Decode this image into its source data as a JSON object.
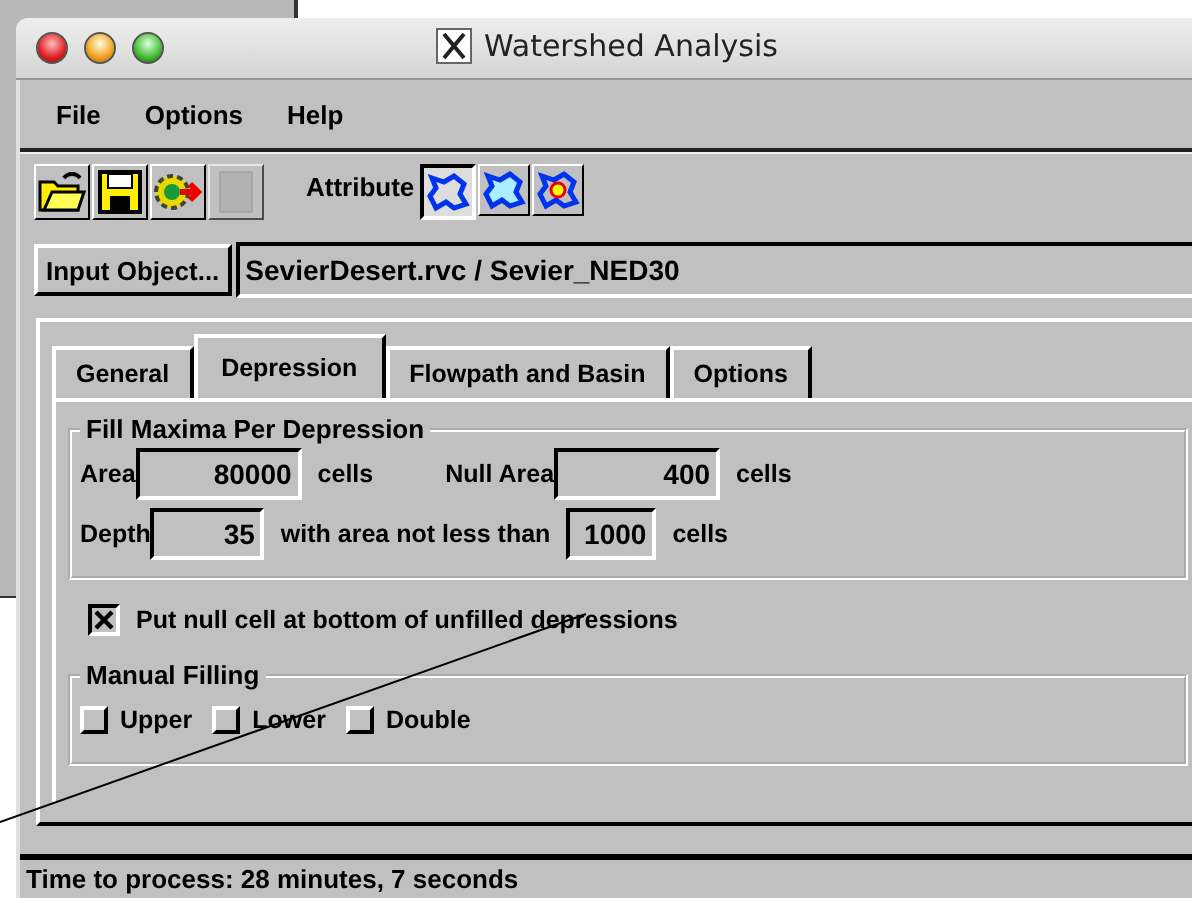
{
  "window": {
    "title": "Watershed Analysis"
  },
  "menu": [
    "File",
    "Options",
    "Help"
  ],
  "toolbar": {
    "tools": [
      {
        "kind": "open",
        "disabled": false
      },
      {
        "kind": "save",
        "disabled": false
      },
      {
        "kind": "run",
        "disabled": false
      },
      {
        "kind": "blank",
        "disabled": true
      }
    ],
    "attribute_label": "Attribute",
    "attribute_buttons": [
      {
        "kind": "outline",
        "selected": true
      },
      {
        "kind": "filled",
        "selected": false
      },
      {
        "kind": "point",
        "selected": false
      }
    ]
  },
  "input": {
    "button": "Input Object...",
    "value": "SevierDesert.rvc / Sevier_NED30"
  },
  "tabs": [
    {
      "label": "General",
      "selected": false
    },
    {
      "label": "Depression",
      "selected": true
    },
    {
      "label": "Flowpath and Basin",
      "selected": false
    },
    {
      "label": "Options",
      "selected": false
    }
  ],
  "fill_group": {
    "title": "Fill Maxima Per Depression",
    "area": {
      "label": "Area",
      "value": "80000",
      "unit": "cells"
    },
    "null_area": {
      "label": "Null Area",
      "value": "400",
      "unit": "cells"
    },
    "depth": {
      "label": "Depth",
      "value": "35",
      "middle": "with area not less than",
      "min_area": "1000",
      "unit": "cells"
    }
  },
  "null_cell": {
    "label": "Put null cell at bottom of unfilled depressions",
    "checked": true
  },
  "manual_group": {
    "title": "Manual Filling",
    "options": [
      {
        "label": "Upper",
        "checked": false
      },
      {
        "label": "Lower",
        "checked": false
      },
      {
        "label": "Double",
        "checked": false
      }
    ]
  },
  "status_bar": "Time to process: 28 minutes, 7 seconds"
}
